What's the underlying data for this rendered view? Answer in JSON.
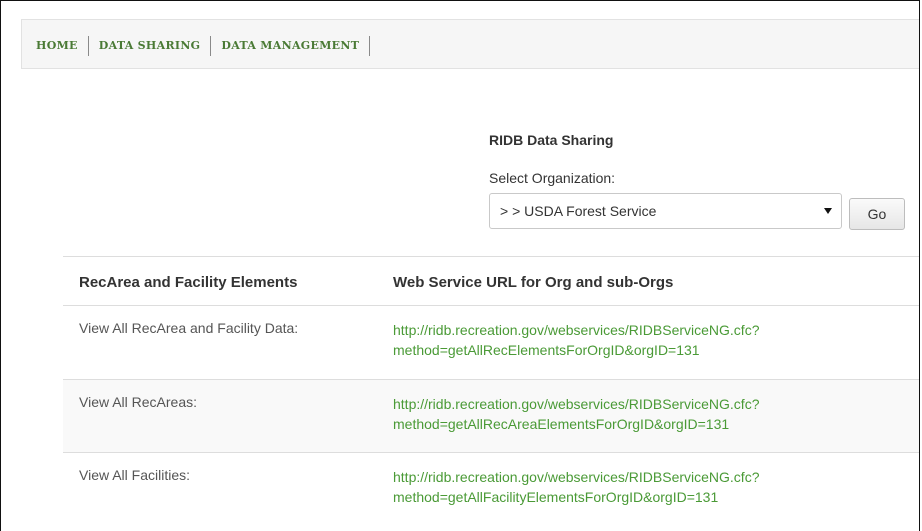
{
  "nav": {
    "items": [
      "HOME",
      "DATA SHARING",
      "DATA MANAGEMENT"
    ]
  },
  "sharing": {
    "title": "RIDB Data Sharing",
    "select_label": "Select Organization:",
    "selected_org": "> > USDA Forest Service",
    "go_label": "Go"
  },
  "table": {
    "headers": [
      "RecArea and Facility Elements",
      "Web Service URL for Org and sub-Orgs"
    ],
    "rows": [
      {
        "label": "View All RecArea and Facility Data:",
        "url_line1": "http://ridb.recreation.gov/webservices/RIDBServiceNG.cfc?",
        "url_line2": "method=getAllRecElementsForOrgID&orgID=131"
      },
      {
        "label": "View All RecAreas:",
        "url_line1": "http://ridb.recreation.gov/webservices/RIDBServiceNG.cfc?",
        "url_line2": "method=getAllRecAreaElementsForOrgID&orgID=131"
      },
      {
        "label": "View All Facilities:",
        "url_line1": "http://ridb.recreation.gov/webservices/RIDBServiceNG.cfc?",
        "url_line2": "method=getAllFacilityElementsForOrgID&orgID=131"
      }
    ]
  },
  "colors": {
    "nav_link": "#4a7a35",
    "url_link": "#4a9a36"
  }
}
